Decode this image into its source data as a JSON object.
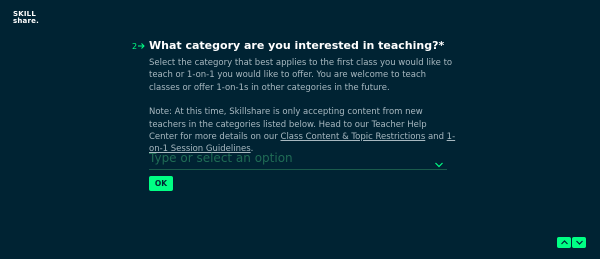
{
  "logo": {
    "line1": "SKILL",
    "line2": "share."
  },
  "question": {
    "number": "2",
    "arrow_icon": "arrow-right-icon",
    "title": "What category are you interested in teaching?*",
    "description": "Select the category that best applies to the first class you would like to teach or 1-on-1 you would like to offer. You are welcome to teach classes or offer 1-on-1s in other categories in the future.",
    "note_prefix": "Note: At this time, Skillshare is only accepting content from new teachers in the categories listed below. Head to our Teacher Help Center for more details on our ",
    "link1": "Class Content & Topic Restrictions",
    "note_and": " and ",
    "link2": "1-on-1 Session Guidelines",
    "note_suffix": "."
  },
  "select": {
    "placeholder": "Type or select an option",
    "icon": "chevron-down-icon"
  },
  "ok_button": {
    "label": "OK"
  },
  "navigation": {
    "up_icon": "chevron-up-icon",
    "down_icon": "chevron-down-icon"
  },
  "colors": {
    "background": "#002333",
    "accent": "#00ff84",
    "text": "#ffffff",
    "muted_text": "#a7b8c0"
  }
}
